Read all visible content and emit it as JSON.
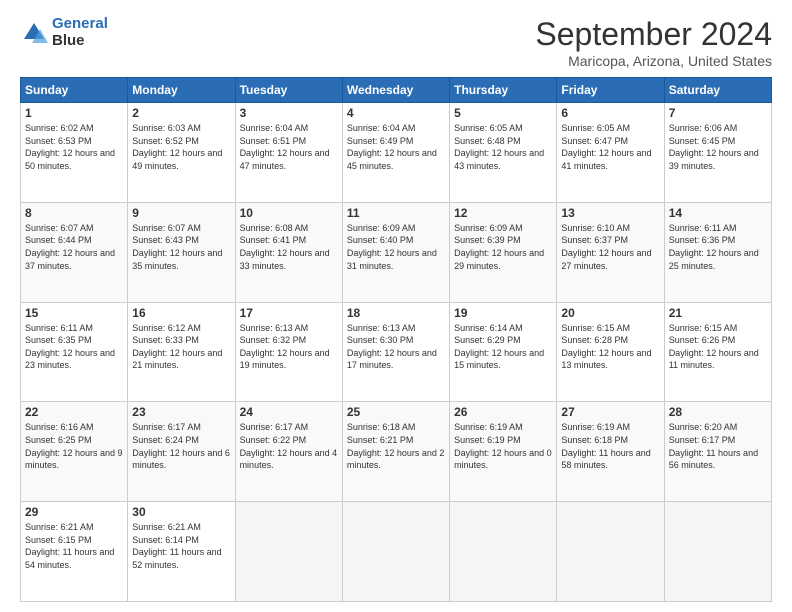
{
  "header": {
    "logo_line1": "General",
    "logo_line2": "Blue",
    "main_title": "September 2024",
    "subtitle": "Maricopa, Arizona, United States"
  },
  "calendar": {
    "days_of_week": [
      "Sunday",
      "Monday",
      "Tuesday",
      "Wednesday",
      "Thursday",
      "Friday",
      "Saturday"
    ],
    "weeks": [
      [
        {
          "day": "1",
          "sunrise": "6:02 AM",
          "sunset": "6:53 PM",
          "daylight": "12 hours and 50 minutes."
        },
        {
          "day": "2",
          "sunrise": "6:03 AM",
          "sunset": "6:52 PM",
          "daylight": "12 hours and 49 minutes."
        },
        {
          "day": "3",
          "sunrise": "6:04 AM",
          "sunset": "6:51 PM",
          "daylight": "12 hours and 47 minutes."
        },
        {
          "day": "4",
          "sunrise": "6:04 AM",
          "sunset": "6:49 PM",
          "daylight": "12 hours and 45 minutes."
        },
        {
          "day": "5",
          "sunrise": "6:05 AM",
          "sunset": "6:48 PM",
          "daylight": "12 hours and 43 minutes."
        },
        {
          "day": "6",
          "sunrise": "6:05 AM",
          "sunset": "6:47 PM",
          "daylight": "12 hours and 41 minutes."
        },
        {
          "day": "7",
          "sunrise": "6:06 AM",
          "sunset": "6:45 PM",
          "daylight": "12 hours and 39 minutes."
        }
      ],
      [
        {
          "day": "8",
          "sunrise": "6:07 AM",
          "sunset": "6:44 PM",
          "daylight": "12 hours and 37 minutes."
        },
        {
          "day": "9",
          "sunrise": "6:07 AM",
          "sunset": "6:43 PM",
          "daylight": "12 hours and 35 minutes."
        },
        {
          "day": "10",
          "sunrise": "6:08 AM",
          "sunset": "6:41 PM",
          "daylight": "12 hours and 33 minutes."
        },
        {
          "day": "11",
          "sunrise": "6:09 AM",
          "sunset": "6:40 PM",
          "daylight": "12 hours and 31 minutes."
        },
        {
          "day": "12",
          "sunrise": "6:09 AM",
          "sunset": "6:39 PM",
          "daylight": "12 hours and 29 minutes."
        },
        {
          "day": "13",
          "sunrise": "6:10 AM",
          "sunset": "6:37 PM",
          "daylight": "12 hours and 27 minutes."
        },
        {
          "day": "14",
          "sunrise": "6:11 AM",
          "sunset": "6:36 PM",
          "daylight": "12 hours and 25 minutes."
        }
      ],
      [
        {
          "day": "15",
          "sunrise": "6:11 AM",
          "sunset": "6:35 PM",
          "daylight": "12 hours and 23 minutes."
        },
        {
          "day": "16",
          "sunrise": "6:12 AM",
          "sunset": "6:33 PM",
          "daylight": "12 hours and 21 minutes."
        },
        {
          "day": "17",
          "sunrise": "6:13 AM",
          "sunset": "6:32 PM",
          "daylight": "12 hours and 19 minutes."
        },
        {
          "day": "18",
          "sunrise": "6:13 AM",
          "sunset": "6:30 PM",
          "daylight": "12 hours and 17 minutes."
        },
        {
          "day": "19",
          "sunrise": "6:14 AM",
          "sunset": "6:29 PM",
          "daylight": "12 hours and 15 minutes."
        },
        {
          "day": "20",
          "sunrise": "6:15 AM",
          "sunset": "6:28 PM",
          "daylight": "12 hours and 13 minutes."
        },
        {
          "day": "21",
          "sunrise": "6:15 AM",
          "sunset": "6:26 PM",
          "daylight": "12 hours and 11 minutes."
        }
      ],
      [
        {
          "day": "22",
          "sunrise": "6:16 AM",
          "sunset": "6:25 PM",
          "daylight": "12 hours and 9 minutes."
        },
        {
          "day": "23",
          "sunrise": "6:17 AM",
          "sunset": "6:24 PM",
          "daylight": "12 hours and 6 minutes."
        },
        {
          "day": "24",
          "sunrise": "6:17 AM",
          "sunset": "6:22 PM",
          "daylight": "12 hours and 4 minutes."
        },
        {
          "day": "25",
          "sunrise": "6:18 AM",
          "sunset": "6:21 PM",
          "daylight": "12 hours and 2 minutes."
        },
        {
          "day": "26",
          "sunrise": "6:19 AM",
          "sunset": "6:19 PM",
          "daylight": "12 hours and 0 minutes."
        },
        {
          "day": "27",
          "sunrise": "6:19 AM",
          "sunset": "6:18 PM",
          "daylight": "11 hours and 58 minutes."
        },
        {
          "day": "28",
          "sunrise": "6:20 AM",
          "sunset": "6:17 PM",
          "daylight": "11 hours and 56 minutes."
        }
      ],
      [
        {
          "day": "29",
          "sunrise": "6:21 AM",
          "sunset": "6:15 PM",
          "daylight": "11 hours and 54 minutes."
        },
        {
          "day": "30",
          "sunrise": "6:21 AM",
          "sunset": "6:14 PM",
          "daylight": "11 hours and 52 minutes."
        },
        {
          "day": "",
          "sunrise": "",
          "sunset": "",
          "daylight": ""
        },
        {
          "day": "",
          "sunrise": "",
          "sunset": "",
          "daylight": ""
        },
        {
          "day": "",
          "sunrise": "",
          "sunset": "",
          "daylight": ""
        },
        {
          "day": "",
          "sunrise": "",
          "sunset": "",
          "daylight": ""
        },
        {
          "day": "",
          "sunrise": "",
          "sunset": "",
          "daylight": ""
        }
      ]
    ]
  }
}
